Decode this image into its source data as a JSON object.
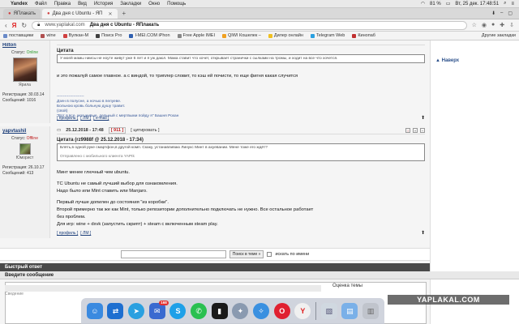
{
  "menubar": {
    "app": "Yandex",
    "items": [
      "Файл",
      "Правка",
      "Вид",
      "История",
      "Закладки",
      "Окно",
      "Помощь"
    ],
    "battery": "81 %",
    "clock": "Вт, 25 дек.  17:48:51"
  },
  "tabs": [
    {
      "label": "ЯПлакать",
      "active": false
    },
    {
      "label": "Два дня с Ubuntu - ЯП",
      "active": true
    }
  ],
  "address": {
    "host": "www.yaplakal.com",
    "title": "Два дня с Ubuntu - ЯПлакать"
  },
  "bookmarks": [
    {
      "label": "поставщики",
      "color": "#6a8ac8"
    },
    {
      "label": "wine",
      "color": "#b05050"
    },
    {
      "label": "Вулкан-М",
      "color": "#d04040"
    },
    {
      "label": "Поиск Pro",
      "color": "#404040"
    },
    {
      "label": "I-MEI.COM iPhon",
      "color": "#3060b0"
    },
    {
      "label": "Free Apple IMEI",
      "color": "#888888"
    },
    {
      "label": "QIWI Кошелек –",
      "color": "#f0a020"
    },
    {
      "label": "Дилер онлайн",
      "color": "#f0c020"
    },
    {
      "label": "Telegram Web",
      "color": "#2aa0e0"
    },
    {
      "label": "Кинопаб",
      "color": "#c03030"
    }
  ],
  "bookmarks_other": "Другие закладки",
  "right_nav": "▲ Наверх",
  "post1": {
    "user": "Hilton",
    "status_label": "Статус:",
    "status": "Online",
    "rank": "Ярила",
    "reg": "Регистрация: 30.03.14",
    "msgs": "Сообщений: 1016",
    "quote_title": "Цитата",
    "quote": "У моей мамы ниисы не ноуте живут уже 6 лет и я уж даюл. Мама ставит что хочет, открывает странички с сылками на тромы, и ходит на все что хочется.",
    "text": "и это пожалуй самое главное. а с виндой, то триплер словит, то кэш ей почисти, то еще фигня какая случится",
    "sig1": "---------------------",
    "sig2": "Дзен в полусне, а ночью в пелуеве.",
    "sig3": "Больною кровь больную душу травит.",
    "sig4": "(свой)",
    "sig5": "\"Вот я все, моя живые, дельный с мертвыми пойду я\" Башня Рохан",
    "actions": [
      "[ профиль ]",
      "[ ЛМ ]",
      "[ e-mail ]"
    ]
  },
  "post2": {
    "user": "yapvtashil",
    "date": "25.12.2018 - 17:48",
    "score": "[ 911 ]",
    "quote_btn": "[ цитировать ]",
    "status_label": "Статус:",
    "status": "Offline",
    "rank": "Юморист",
    "reg": "Регистрация: 26.10.17",
    "msgs": "Сообщений: 413",
    "quote_title": "Цитата (rz9988f @ 25.12.2018 - 17:34)",
    "quote_l1": "Блять,в одной руке смартфон,в другой комп. Скаку, устанавливаю Линукс Минт в ахуевании. Мене тоже его ждёт?",
    "quote_l2": "Отправлено с мобильного клиента YAPIk",
    "lines": [
      "Минт менее глючный чем ubuntu.",
      "",
      "ТС Ubuntu не самый лучший выбор для ознакомления.",
      "Надо было или Mint ставить или Manjaro.",
      "",
      "Первый лучше допилен до состояния \"из коробки\".",
      "Второй примерно так же как Mint, только репозитории дополнительно подключать не нужно. Все остальное работает",
      "без проблем.",
      "Для игр: wine + dxvk (запустить скрипт) + steam с включенным steam play."
    ],
    "actions": [
      "[ профиль ]",
      "[ ЛМ ]"
    ]
  },
  "search": {
    "button": "Поиск в теме »",
    "checkbox_label": "искать по имени"
  },
  "quick_reply": "Быстрый ответ",
  "compose": "Введите сообщение",
  "placeholder": "Сведение",
  "rate": "Оценка темы",
  "watermark": "YAPLAKAL.COM",
  "dock": [
    {
      "name": "finder-icon",
      "color": "#3a8ae0",
      "glyph": "☺",
      "round": false
    },
    {
      "name": "teamviewer-icon",
      "color": "#1e6fd0",
      "glyph": "⇄",
      "round": false
    },
    {
      "name": "telegram-icon",
      "color": "#2aa0e0",
      "glyph": "➤",
      "round": true
    },
    {
      "name": "mail-app-icon",
      "color": "#3a6ad0",
      "glyph": "✉",
      "round": false,
      "badge": "168"
    },
    {
      "name": "skype-icon",
      "color": "#1ea0e8",
      "glyph": "S",
      "round": true
    },
    {
      "name": "whatsapp-icon",
      "color": "#2ac050",
      "glyph": "✆",
      "round": true
    },
    {
      "name": "activity-icon",
      "color": "#1a1a1a",
      "glyph": "▮",
      "round": false
    },
    {
      "name": "launchpad-icon",
      "color": "#8a9ab0",
      "glyph": "✦",
      "round": true
    },
    {
      "name": "safari-icon",
      "color": "#3a90e0",
      "glyph": "✧",
      "round": true
    },
    {
      "name": "opera-icon",
      "color": "#e02030",
      "glyph": "O",
      "round": true
    },
    {
      "name": "yandex-browser-icon",
      "color": "#f0f0f0",
      "glyph": "Y",
      "round": true
    },
    {
      "name": "preview-icon",
      "color": "#d0d8e0",
      "glyph": "▧",
      "round": false
    },
    {
      "name": "folder-icon",
      "color": "#7ab0e8",
      "glyph": "▤",
      "round": false
    },
    {
      "name": "trash-icon",
      "color": "#c0c4cc",
      "glyph": "▥",
      "round": false
    }
  ]
}
